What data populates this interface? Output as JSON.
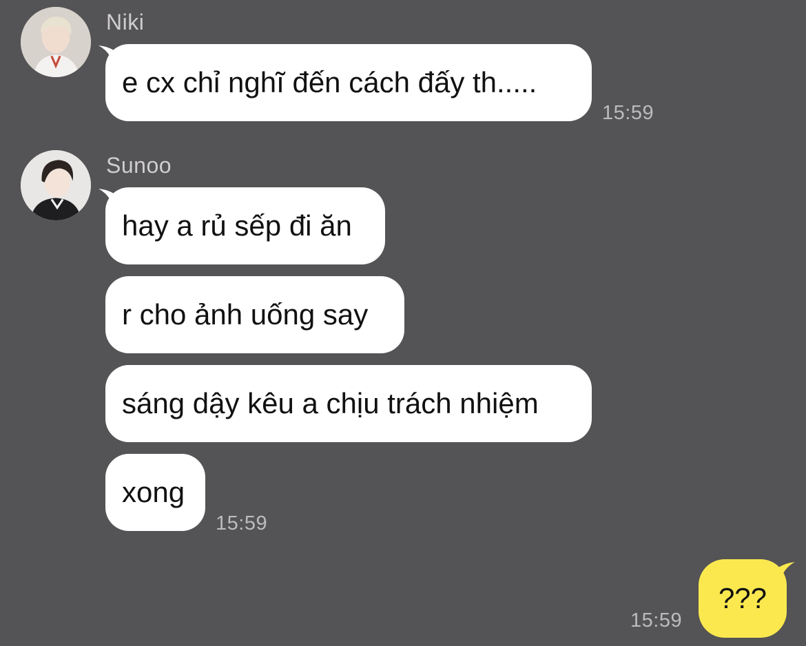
{
  "theme": {
    "background": "#545355",
    "incoming_bubble": "#ffffff",
    "outgoing_bubble": "#fbe84f"
  },
  "messages": {
    "niki": {
      "sender": "Niki",
      "avatar_icon": "profile-photo",
      "bubbles": [
        "e cx chỉ nghĩ đến cách đấy th....."
      ],
      "time": "15:59"
    },
    "sunoo": {
      "sender": "Sunoo",
      "avatar_icon": "profile-photo",
      "bubbles": [
        "hay a rủ sếp đi ăn",
        "r cho ảnh uống say",
        "sáng dậy kêu a chịu trách nhiệm",
        "xong"
      ],
      "time": "15:59"
    },
    "me": {
      "bubbles": [
        "???"
      ],
      "time": "15:59"
    }
  }
}
